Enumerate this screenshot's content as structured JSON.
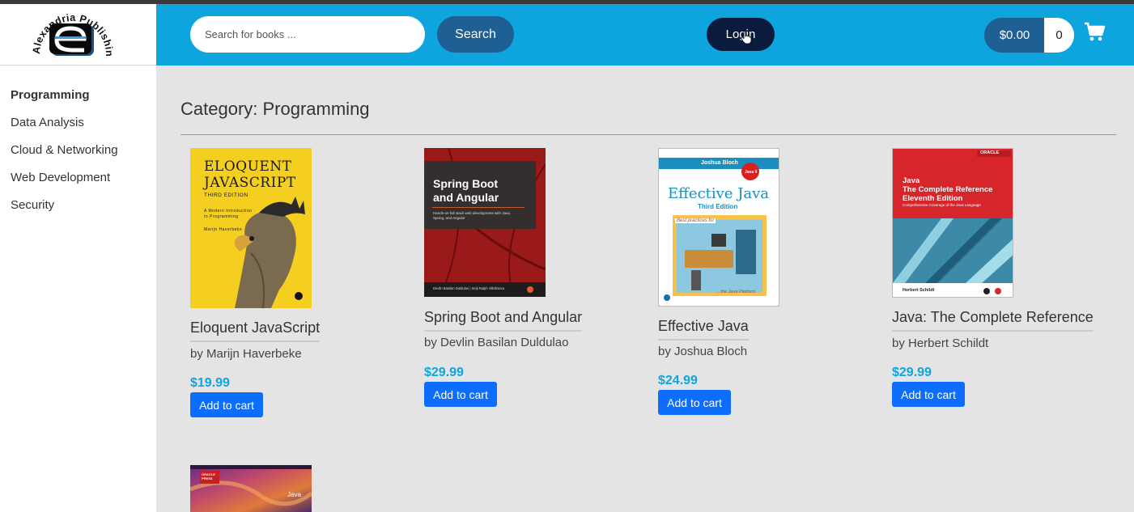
{
  "logo": {
    "text": "Alexandria Publishing"
  },
  "header": {
    "search_placeholder": "Search for books ...",
    "search_label": "Search",
    "login_label": "Login",
    "cart_total": "$0.00",
    "cart_count": "0"
  },
  "sidebar": {
    "items": [
      {
        "label": "Programming",
        "active": true
      },
      {
        "label": "Data Analysis"
      },
      {
        "label": "Cloud & Networking"
      },
      {
        "label": "Web Development"
      },
      {
        "label": "Security"
      }
    ]
  },
  "main": {
    "title": "Category: Programming",
    "books": [
      {
        "title": "Eloquent JavaScript",
        "author": "by Marijn Haverbeke",
        "price": "$19.99",
        "button": "Add to cart",
        "cover": {
          "line1": "ELOQUENT",
          "line2": "JAVASCRIPT",
          "edition": "THIRD EDITION",
          "sub": "A Modern Introduction to Programming",
          "by": "Marijn Haverbeke"
        }
      },
      {
        "title": "Spring Boot and Angular",
        "author": "by Devlin Basilan Duldulao",
        "price": "$29.99",
        "button": "Add to cart",
        "cover": {
          "line1": "Spring Boot",
          "line2": "and Angular",
          "sub": "Hands-on full stack web development with Java, Spring, and Angular",
          "by": "Devlin Basilan Duldulao | Seiji Ralph Villafranca"
        }
      },
      {
        "title": "Effective Java",
        "author": "by Joshua Bloch",
        "price": "$24.99",
        "button": "Add to cart",
        "cover": {
          "author": "Joshua Bloch",
          "line1": "Effective Java",
          "edition": "Third Edition",
          "badge": "Java 9",
          "tag1": "Best practices for",
          "tag2": "...the Java Platform"
        }
      },
      {
        "title": "Java: The Complete Reference",
        "author": "by Herbert Schildt",
        "price": "$29.99",
        "button": "Add to cart",
        "cover": {
          "brand": "ORACLE",
          "line1": "Java",
          "line2": "The Complete Reference",
          "line3": "Eleventh Edition",
          "sub": "Comprehensive Coverage of the Java Language",
          "by": "Herbert Schildt"
        }
      },
      {
        "cover": {
          "brand": "ORACLE PRESS",
          "lang": "Java"
        }
      }
    ]
  },
  "colors": {
    "header": "#0ea5df",
    "dark_button": "#1e5f94",
    "login": "#0b1b3d",
    "add_button": "#0d6efd",
    "price": "#0ea5df"
  }
}
